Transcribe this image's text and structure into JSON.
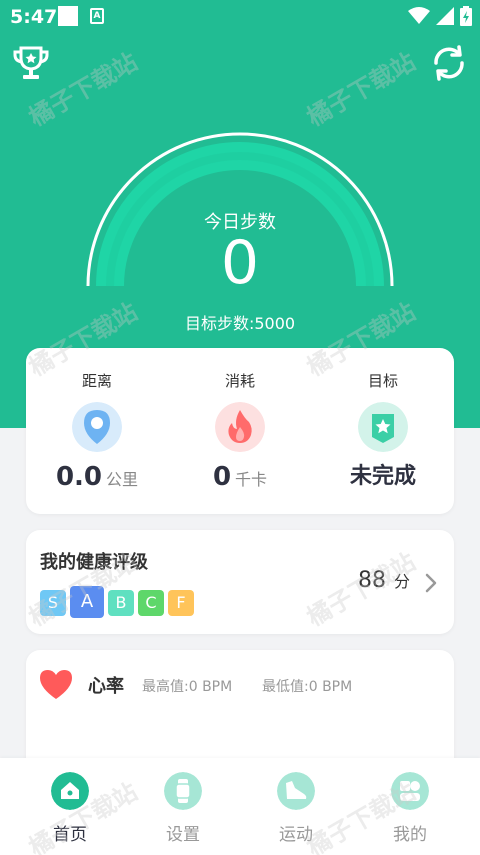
{
  "status_bar": {
    "time": "5:47",
    "a_label": "A"
  },
  "steps": {
    "label": "今日步数",
    "value": "0",
    "goal_text": "目标步数:5000"
  },
  "stats": [
    {
      "label": "距离",
      "value": "0.0",
      "unit": "公里"
    },
    {
      "label": "消耗",
      "value": "0",
      "unit": "千卡"
    },
    {
      "label": "目标",
      "value": "未完成",
      "unit": ""
    }
  ],
  "health": {
    "title": "我的健康评级",
    "grades": [
      "S",
      "A",
      "B",
      "C",
      "F"
    ],
    "score": "88",
    "score_unit": "分"
  },
  "heart_rate": {
    "title": "心率",
    "max": "最高值:0 BPM",
    "min": "最低值:0 BPM"
  },
  "tabs": [
    {
      "label": "首页"
    },
    {
      "label": "设置"
    },
    {
      "label": "运动"
    },
    {
      "label": "我的"
    }
  ],
  "watermark": "橘子下载站",
  "colors": {
    "primary": "#21bc93",
    "gauge_arc": "#1fd5a6",
    "grade_S": "#6fc8f5",
    "grade_A": "#5b8df0",
    "grade_B": "#5fe0c0",
    "grade_C": "#5ed76a",
    "grade_F": "#ffc45a",
    "heart": "#ff5a5a"
  }
}
